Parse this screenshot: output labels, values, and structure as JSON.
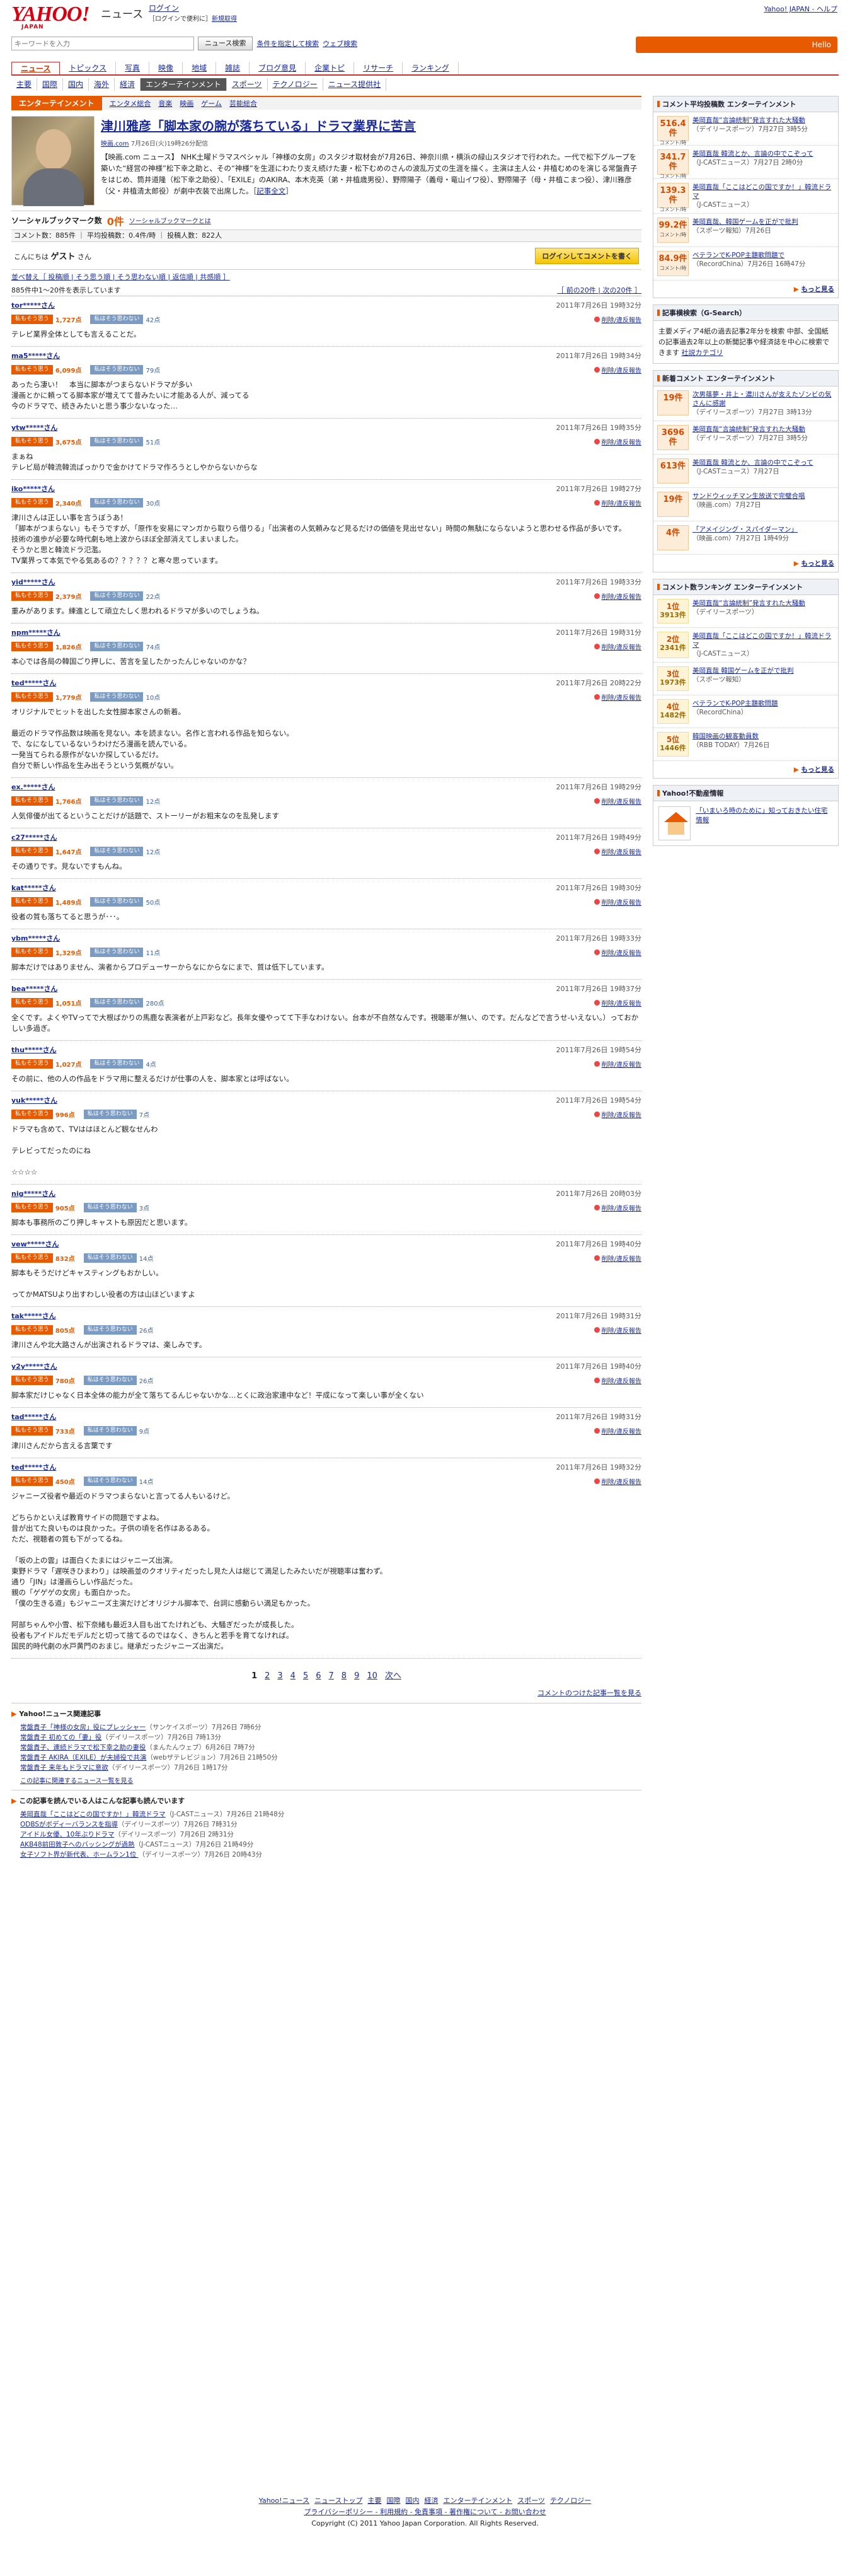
{
  "header": {
    "logo": "YAHOO!",
    "logo_sub": "JAPAN",
    "site_title": "ニュース",
    "login": "ログイン",
    "login_sub": "［ログインで便利に］",
    "new_reg": "新規取得",
    "right_links": "Yahoo! JAPAN - ヘルプ",
    "search_placeholder": "キーワードを入力",
    "search_btn": "ニュース検索",
    "search_link1": "条件を指定して検索",
    "search_link2": "ウェブ検索",
    "date_label": "Hello"
  },
  "gnav": [
    "ニュース",
    "トピックス",
    "写真",
    "映像",
    "地域",
    "雑誌",
    "ブログ意見",
    "企業トピ",
    "リサーチ",
    "ランキング"
  ],
  "gnav_active": 0,
  "snav": [
    "主要",
    "国際",
    "国内",
    "海外",
    "経済",
    "エンターテインメント",
    "スポーツ",
    "テクノロジー",
    "ニュース提供社"
  ],
  "snav_active": 5,
  "entbar": {
    "cat": "エンターテインメント",
    "links": [
      "エンタメ総合",
      "音楽",
      "映画",
      "ゲーム",
      "芸能総合"
    ]
  },
  "article": {
    "title": "津川雅彦「脚本家の腕が落ちている」ドラマ業界に苦言",
    "source": "映画.com",
    "meta": "7月26日(火)19時26分配信",
    "body": "【映画.com ニュース】 NHK土曜ドラマスペシャル「神様の女房」のスタジオ取材会が7月26日、神奈川県・横浜の緑山スタジオで行われた。一代で松下グループを築いた“経営の神様”松下幸之助と、その“神様”を生涯にわたり支え続けた妻・松下むめのさんの波乱万丈の生涯を描く。主演は主人公・井植むめのを演じる常盤貴子をはじめ、筒井道隆（松下幸之助役）、「EXILE」のAKIRA、本木克英（弟・井植歳男役）、野際陽子（義母・竜山イワ役）、野際陽子（母・井植こまつ役）、津川雅彦（父・井植清太郎役）が劇中衣装で出席した。［",
    "more": "記事全文"
  },
  "social": {
    "label": "ソーシャルブックマーク数",
    "count": "0件",
    "help": "ソーシャルブックマークとは"
  },
  "stats": "コメント数：885件 ｜ 平均投稿数：0.4件/時 ｜ 投稿人数：822人",
  "greet": {
    "hello": "こんにちは",
    "name": "ゲスト",
    "suffix": "さん",
    "btn": "ログインしてコメントを書く"
  },
  "sort": "並べ替え［ 投稿順 | そう思う順 | そう思わない順 | 返信順 | 共感順 ］",
  "page_info": "885件中1〜20件を表示しています",
  "page_nav": "［ 前の20件 | 次の20件 ］",
  "agree_btn": "私もそう思う",
  "disagree_btn": "私はそう思わない",
  "report": "削除/違反報告",
  "comments": [
    {
      "user": "tor*****さん",
      "time": "2011年7月26日 19時32分",
      "agree": "1,727点",
      "disagree": "42点",
      "text": "テレビ業界全体としても言えることだ。"
    },
    {
      "user": "ma5*****さん",
      "time": "2011年7月26日 19時34分",
      "agree": "6,099点",
      "disagree": "79点",
      "text": "あったら凄い！　本当に脚本がつまらないドラマが多い\n漫画とかに頼ってる脚本家が増えてて昔みたいに才能ある人が、減ってる\n今のドラマで、続きみたいと思う事少ないなった…"
    },
    {
      "user": "ytw*****さん",
      "time": "2011年7月26日 19時35分",
      "agree": "3,675点",
      "disagree": "51点",
      "text": "まぁね\nテレビ局が韓流韓流ばっかりで金かけてドラマ作ろうとしやからないからな"
    },
    {
      "user": "iko*****さん",
      "time": "2011年7月26日 19時27分",
      "agree": "2,340点",
      "disagree": "30点",
      "text": "津川さんは正しい事を言うぼうあ！\n「脚本がつまらない」もそうですが、「原作を安易にマンガから取りら借りる」「出演者の人気頼みなど見るだけの価値を見出せない」時間の無駄にならないようと思わせる作品が多いです。\n技術の進歩が必要な時代劇も地上波からほぼ全部消えてしまいました。\nそうかと思と韓流ドラ氾濫。\nTV業界って本気でやる気あるの？？？？？と寒々思っています。"
    },
    {
      "user": "yid*****さん",
      "time": "2011年7月26日 19時33分",
      "agree": "2,379点",
      "disagree": "22点",
      "text": "重みがあります。練進として頑立たしく思われるドラマが多いのでしょうね。"
    },
    {
      "user": "npm*****さん",
      "time": "2011年7月26日 19時31分",
      "agree": "1,826点",
      "disagree": "74点",
      "text": "本心では各局の韓国ごり押しに、苦言を呈したかったんじゃないのかな？"
    },
    {
      "user": "ted*****さん",
      "time": "2011年7月26日 20時22分",
      "agree": "1,779点",
      "disagree": "10点",
      "text": "オリジナルでヒットを出した女性脚本家さんの新着。\n\n最近のドラマ作品数は映画を見ない。本を読まない。名作と言われる作品を知らない。\nで、なになしているないうわけだろ漫画を読んでいる。\n一発当てられる原作がないか探しているだけ。\n自分で新しい作品を生み出そうという気概がない。"
    },
    {
      "user": "ex.*****さん",
      "time": "2011年7月26日 19時29分",
      "agree": "1,766点",
      "disagree": "12点",
      "text": "人気俳優が出てるということだけが話題で、ストーリーがお粗末なのを乱発します"
    },
    {
      "user": "c27*****さん",
      "time": "2011年7月26日 19時49分",
      "agree": "1,647点",
      "disagree": "12点",
      "text": "その通りです。見ないですもんね。"
    },
    {
      "user": "kat*****さん",
      "time": "2011年7月26日 19時30分",
      "agree": "1,489点",
      "disagree": "50点",
      "text": "役者の質も落ちてると思うが･･･。"
    },
    {
      "user": "ybm*****さん",
      "time": "2011年7月26日 19時33分",
      "agree": "1,329点",
      "disagree": "11点",
      "text": "脚本だけではありません、演者からプロデューサーからなにからなにまで、質は低下しています。"
    },
    {
      "user": "bea*****さん",
      "time": "2011年7月26日 19時37分",
      "agree": "1,051点",
      "disagree": "280点",
      "text": "全くです。よくやTVってで大根ばかりの馬鹿な表演者が上戸彩など。長年女優やってて下手なわけない。台本が不自然なんです。視聴率が無い、のです。だんなどで言うせ-いえない。）っておかしい多過ぎ。"
    },
    {
      "user": "thu*****さん",
      "time": "2011年7月26日 19時54分",
      "agree": "1,027点",
      "disagree": "4点",
      "text": "その前に、他の人の作品をドラマ用に整えるだけが仕事の人を、脚本家とは呼ばない。"
    },
    {
      "user": "yuk*****さん",
      "time": "2011年7月26日 19時54分",
      "agree": "996点",
      "disagree": "7点",
      "text": "ドラマも含めて、TVははほとんど観なせんわ\n\nテレビってだったのにね\n\n☆☆☆☆"
    },
    {
      "user": "nig*****さん",
      "time": "2011年7月26日 20時03分",
      "agree": "905点",
      "disagree": "3点",
      "text": "脚本も事務所のごり押しキャストも原因だと思います。"
    },
    {
      "user": "vew*****さん",
      "time": "2011年7月26日 19時40分",
      "agree": "832点",
      "disagree": "14点",
      "text": "脚本もそうだけどキャスティングもおかしい。\n\nってかMATSUより出すわしい役者の方は山ほどいますよ"
    },
    {
      "user": "tak*****さん",
      "time": "2011年7月26日 19時31分",
      "agree": "805点",
      "disagree": "26点",
      "text": "津川さんや北大路さんが出演されるドラマは、楽しみです。"
    },
    {
      "user": "y2y*****さん",
      "time": "2011年7月26日 19時40分",
      "agree": "780点",
      "disagree": "26点",
      "text": "脚本家だけじゃなく日本全体の能力が全て落ちてるんじゃないかな…とくに政治家連中など！平成になって楽しい事が全くない"
    },
    {
      "user": "tad*****さん",
      "time": "2011年7月26日 19時31分",
      "agree": "733点",
      "disagree": "9点",
      "text": "津川さんだから言える言葉です"
    },
    {
      "user": "ted*****さん",
      "time": "2011年7月26日 19時32分",
      "agree": "450点",
      "disagree": "14点",
      "text": "ジャニーズ役者や最近のドラマつまらないと言ってる人もいるけど。\n\nどちらかといえば教育サイドの問題ですよね。\n昔が出てた良いものは良かった。子供の頃を名作はあるある。\nただ、視聴者の質も下がってるね。\n\n「坂の上の雲」は面白くたまにはジャニーズ出演。\n東野ドラマ「遅咲きひまわり」は映画並のクオリティだったし見た人は総じて満足したみたいだが視聴率は奮わず。\n通り「JIN」は漫画らしい作品だった。\n親の「ゲゲゲの女房」も面白かった。\n「僕の生きる道」もジャニーズ主演だけどオリジナル脚本で、台詞に感動らい満足もかった。\n\n阿部ちゃんや小雪、松下奈緒も最近3人目も出てたけれども、大騒ぎだったが成長した。\n役者もアイドルだモデルだと切って捨てるのではなく、きちんと若手を育てなければ。\n国民的時代劇の水戸黄門のおまじ。継承だったジャニーズ出演だ。"
    }
  ],
  "pager": [
    "1",
    "2",
    "3",
    "4",
    "5",
    "6",
    "7",
    "8",
    "9",
    "10",
    "次へ"
  ],
  "pager_bottom": "コメントのつけた記事一覧を見る",
  "related": {
    "title": "Yahoo!ニュース関連記事",
    "items": [
      {
        "t": "常盤貴子「神様の女房」役にプレッシャー",
        "s": "（サンケイスポーツ）7月26日 7時6分"
      },
      {
        "t": "常盤貴子 初めての「妻」役",
        "s": "（デイリースポーツ）7月26日 7時13分"
      },
      {
        "t": "常盤貴子、連続ドラマで松下幸之助の妻役",
        "s": "（まんたんウェブ）6月26日 7時7分"
      },
      {
        "t": "常盤貴子 AKIRA（EXILE）が夫婦役で共演",
        "s": "（webザテレビジョン）7月26日 21時50分"
      },
      {
        "t": "常盤貴子 来年もドラマに意欲",
        "s": "（デイリースポーツ）7月26日 1時17分"
      }
    ],
    "more": "この記事に関連するニュース一覧を見る"
  },
  "related2": {
    "title": "この記事を読んでいる人はこんな記事も読んでいます",
    "items": [
      {
        "t": "美岡直哉「ここはどこの国ですか！」韓流ドラマ",
        "s": "（J-CASTニュース）7月26日 21時48分"
      },
      {
        "t": "ODBSがボディーバランスを指導",
        "s": "（デイリースポーツ）7月26日 7時31分"
      },
      {
        "t": "アイドル女優、10年ぶりドラマ",
        "s": "（デイリースポーツ）7月26日 2時31分"
      },
      {
        "t": "AKB48前田敦子へのバッシングが過熱",
        "s": "（J-CASTニュース）7月26日 21時49分"
      },
      {
        "t": "女子ソフト界が新代表、ホームラン1位 ",
        "s": "（デイリースポーツ）7月26日 20時43分"
      }
    ]
  },
  "footer": {
    "links": [
      "Yahoo!ニュース",
      "ニューストップ",
      "主要",
      "国際",
      "国内",
      "経済",
      "エンターテインメント",
      "スポーツ",
      "テクノロジー"
    ],
    "links2": "プライバシーポリシー - 利用規約 - 免責事項 - 著作権について - お問い合わせ",
    "copy": "Copyright (C) 2011 Yahoo Japan Corporation. All Rights Reserved."
  },
  "side": {
    "box1": {
      "title": "コメント平均投稿数 エンターテインメント",
      "items": [
        {
          "n": "516.4件",
          "u": "コメント/時",
          "t": "美岡直哉“言論統制”発言すれた大騒動",
          "s": "（デイリースポーツ）7月27日 3時5分"
        },
        {
          "n": "341.7件",
          "u": "コメント/時",
          "t": "美岡直哉 韓流とか、言論の中でこぞって",
          "s": "（J-CASTニュース）7月27日 2時0分"
        },
        {
          "n": "139.3件",
          "u": "コメント/時",
          "t": "美岡直哉「ここはどこの国ですか！」韓流ドラマ",
          "s": "（J-CASTニュース）"
        },
        {
          "n": "99.2件",
          "u": "コメント/時",
          "t": "美岡直哉、韓国ゲームを正がで批判",
          "s": "（スポーツ報知）7月26日"
        },
        {
          "n": "84.9件",
          "u": "コメント/時",
          "t": "ベテランでK-POP主題歌問題で",
          "s": "（RecordChina）7月26日 16時47分"
        }
      ]
    },
    "box1_more": "もっと見る",
    "sw": {
      "title": "記事横検索（G-Search）",
      "text": "主要メディア4紙の過去記事2年分を検索 中部、全国紙の記事過去2年以上の新聞記事や経済誌を中心に検索できます",
      "link": "社説カテゴリ"
    },
    "box2": {
      "title": "新着コメント エンターテインメント",
      "items": [
        {
          "n": "19件",
          "t": "次男篠夢・井上・濃川さんが支えたゾンビの気さんに感謝",
          "s": "（デイリースポーツ）7月27日 3時13分"
        },
        {
          "n": "3696件",
          "t": "美岡直哉“言論統制”発言すれた大騒動",
          "s": "（デイリースポーツ）7月27日 3時5分"
        },
        {
          "n": "613件",
          "t": "美岡直哉 韓流とか、言論の中でこぞって",
          "s": "（J-CASTニュース）7月27日"
        },
        {
          "n": "19件",
          "t": "サンドウィッチマン生放送で完璧合唱",
          "s": "（映画.com）7月27日"
        },
        {
          "n": "4件",
          "t": "「アメイジング・スパイダーマン」",
          "s": "（映画.com）7月27日 1時49分"
        }
      ]
    },
    "box3": {
      "title": "コメント数ランキング エンターテインメント",
      "items": [
        {
          "r": "1位",
          "n": "3913件",
          "t": "美岡直哉“言論統制”発言すれた大騒動",
          "s": "（デイリースポーツ）"
        },
        {
          "r": "2位",
          "n": "2341件",
          "t": "美岡直哉「ここはどこの国ですか！」韓流ドラマ",
          "s": "（J-CASTニュース）"
        },
        {
          "r": "3位",
          "n": "1973件",
          "t": "美岡直哉 韓国ゲームを正がで批判",
          "s": "（スポーツ報知）"
        },
        {
          "r": "4位",
          "n": "1482件",
          "t": "ベテランでK-POP主題歌問題",
          "s": "（RecordChina）"
        },
        {
          "r": "5位",
          "n": "1446件",
          "t": "韓国映画の観客動員数",
          "s": "（RBB TODAY）7月26日"
        }
      ]
    },
    "yc": {
      "title": "Yahoo!不動産情報",
      "text": "「いまいろ時のために」知っておきたい住宅情報"
    }
  }
}
